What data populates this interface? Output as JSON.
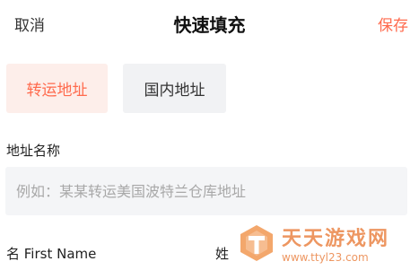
{
  "header": {
    "cancel_label": "取消",
    "title": "快速填充",
    "save_label": "保存"
  },
  "address_type": {
    "options": [
      "转运地址",
      "国内地址"
    ],
    "selected": "转运地址"
  },
  "address_name": {
    "label": "地址名称",
    "value": "",
    "placeholder": "例如：某某转运美国波特兰仓库地址"
  },
  "name_fields": {
    "first_name_label": "名 First Name",
    "last_name_label": "姓"
  },
  "watermark": {
    "title": "天天游戏网",
    "url": "www.ttyl23.com"
  },
  "colors": {
    "accent": "#ff6a4d",
    "selected_chip_bg": "#fdeeea",
    "chip_bg": "#f1f2f4",
    "input_bg": "#f4f5f7"
  }
}
